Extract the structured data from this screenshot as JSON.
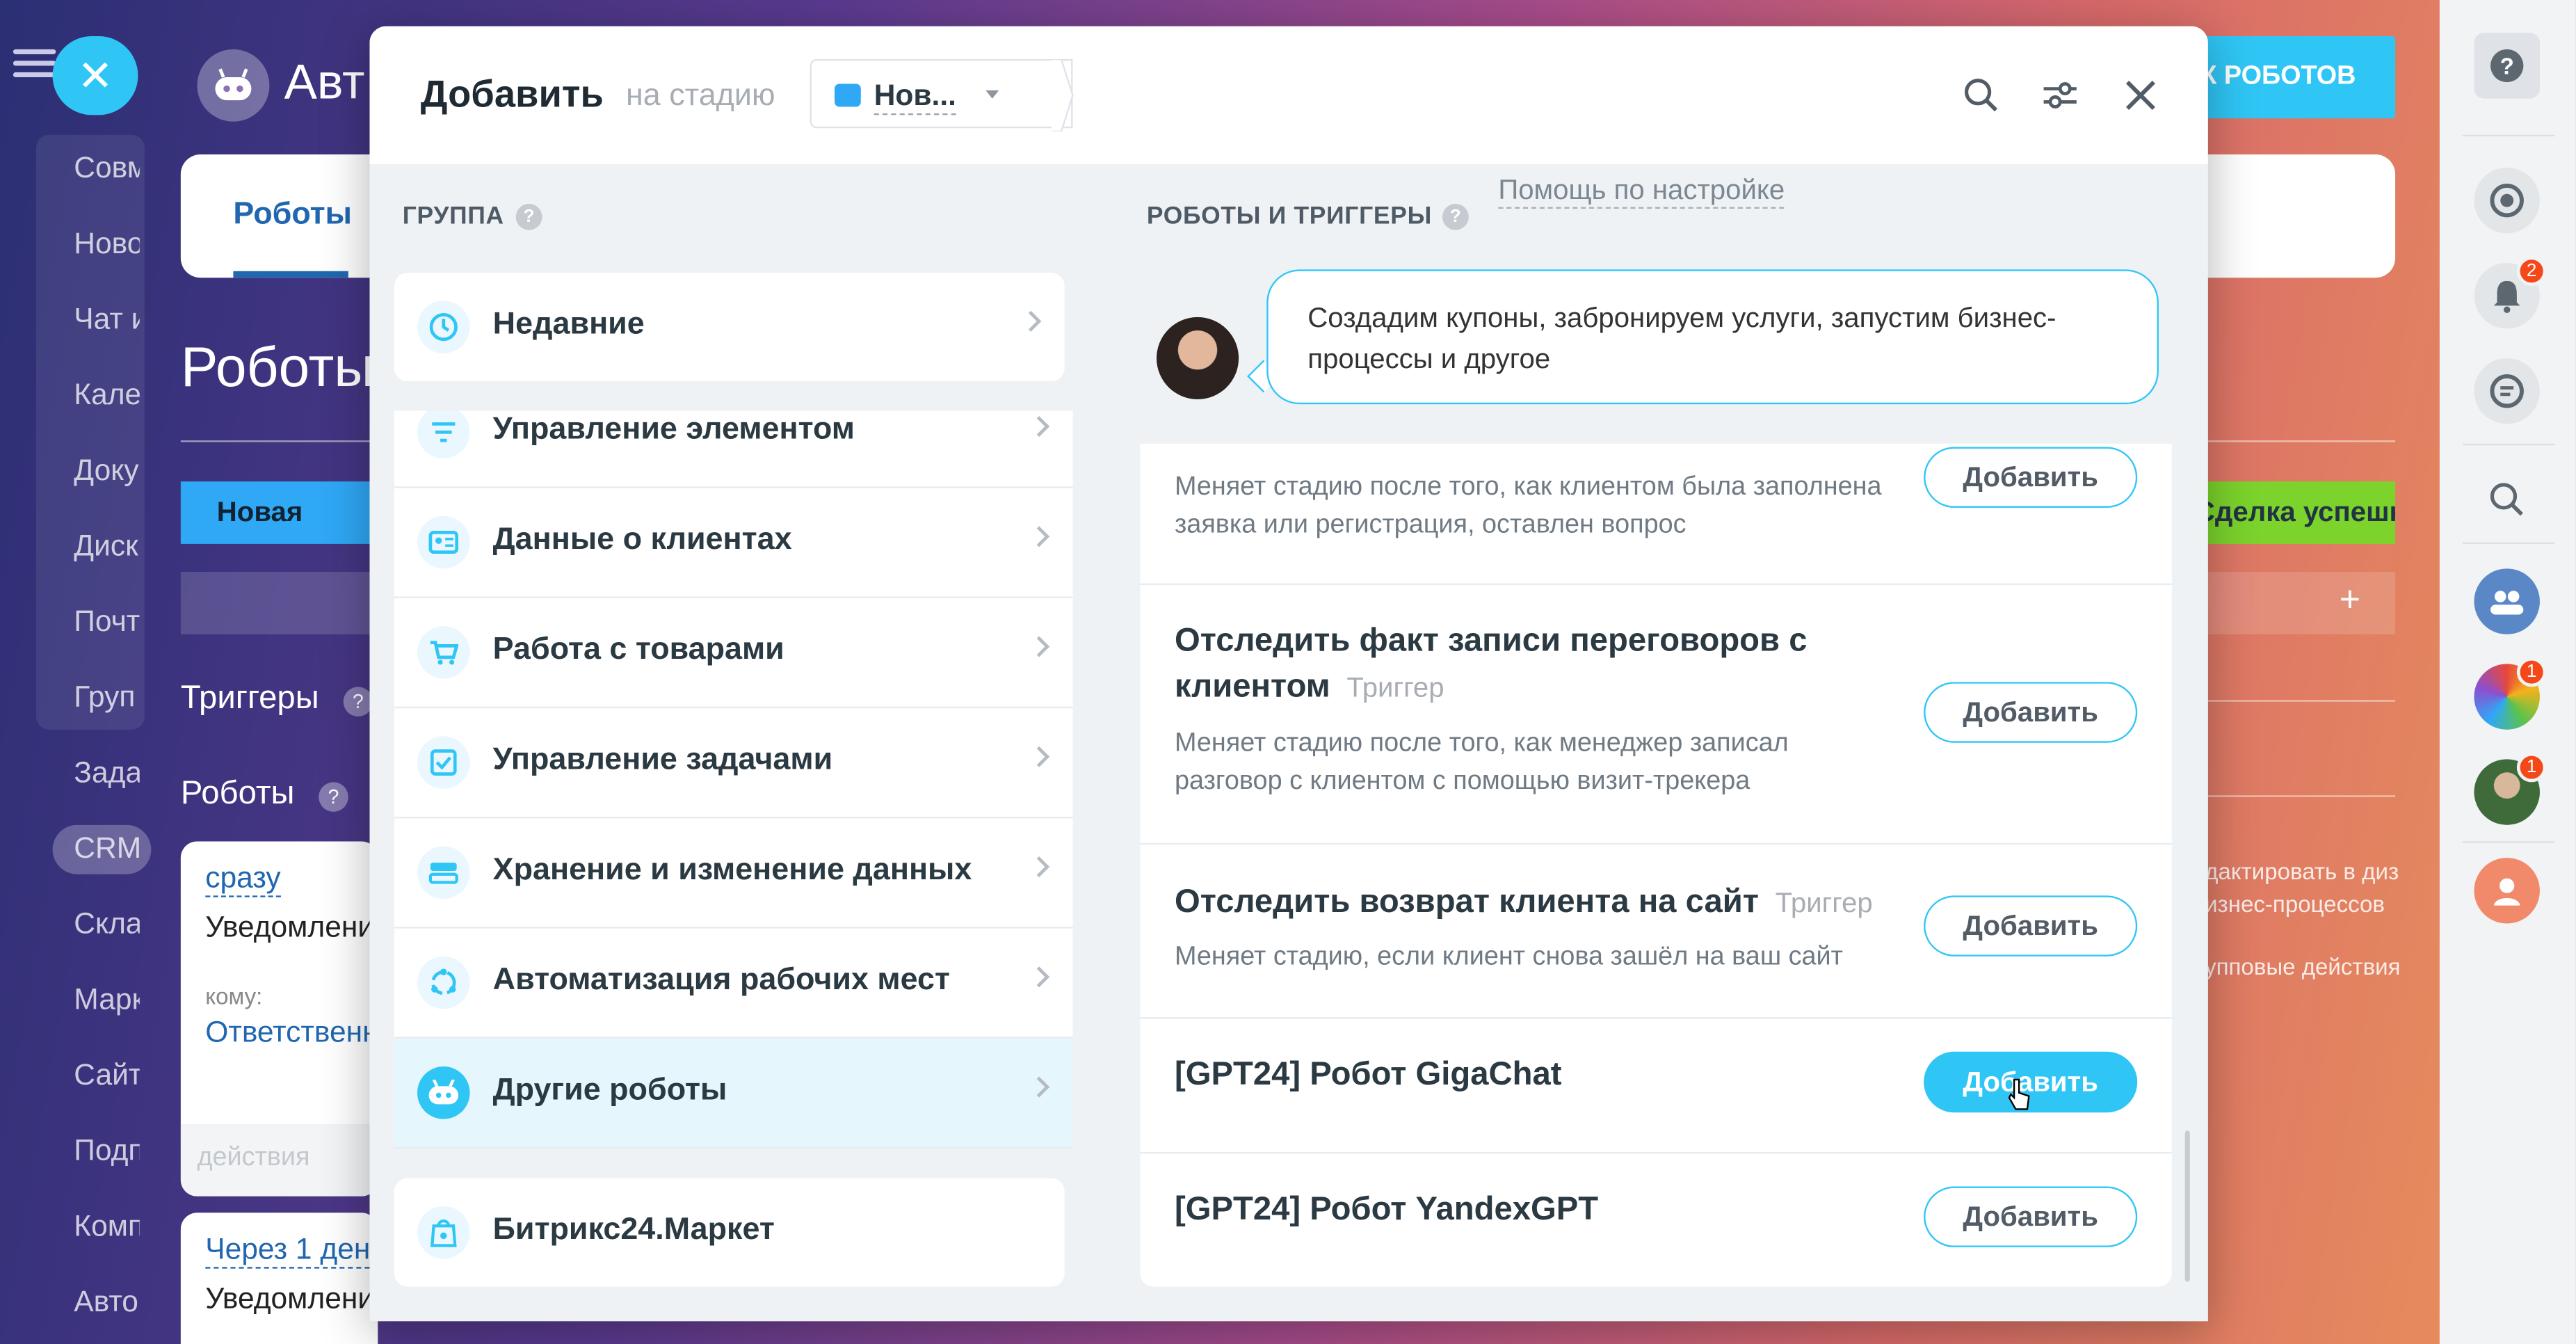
{
  "background": {
    "title_fragment": "Авт",
    "robots_button": "К РОБОТОВ",
    "tab_robots": "Роботы",
    "heading": "Роботы",
    "stage_new": "Новая",
    "stage_won": "Сделка успешн",
    "triggers_label": "Триггеры",
    "robots_label": "Роботы",
    "nav_items": [
      "Совм",
      "Ново",
      "Чат и",
      "Кале",
      "Доку",
      "Диск",
      "Почт",
      "Груп",
      "Зада",
      "CRM",
      "Скла",
      "Марк",
      "Сайт",
      "Подп",
      "Комп",
      "Авто"
    ],
    "card1": {
      "when": "сразу",
      "title": "Уведомлени",
      "to_label": "кому:",
      "to_value": "Ответственн",
      "actions": "действия"
    },
    "card2": {
      "when": "Через 1 ден",
      "title": "Уведомлени"
    },
    "note1": "дактировать в диз",
    "note2": "изнес-процессов",
    "note3": "упповые действия"
  },
  "modal": {
    "title": "Добавить",
    "subtitle": "на стадию",
    "stage": {
      "label": "Нов...",
      "color": "#2fa8f6"
    },
    "left": {
      "heading": "ГРУППА",
      "recent": "Недавние",
      "groups": [
        {
          "label": "Управление элементом",
          "icon": "filter-icon"
        },
        {
          "label": "Данные о клиентах",
          "icon": "contact-card-icon"
        },
        {
          "label": "Работа с товарами",
          "icon": "cart-icon"
        },
        {
          "label": "Управление задачами",
          "icon": "task-check-icon"
        },
        {
          "label": "Хранение и изменение данных",
          "icon": "storage-icon"
        },
        {
          "label": "Автоматизация рабочих мест",
          "icon": "workflow-icon"
        },
        {
          "label": "Другие роботы",
          "icon": "robot-icon",
          "active": true
        }
      ],
      "market": "Битрикс24.Маркет"
    },
    "right": {
      "heading": "РОБОТЫ И ТРИГГЕРЫ",
      "help_link": "Помощь по настройке",
      "hint": "Создадим купоны, забронируем услуги, запустим бизнес-процессы и другое",
      "items": [
        {
          "title": "",
          "tag": "",
          "desc": "Меняет стадию после того, как клиентом была заполнена заявка или регистрация, оставлен вопрос",
          "button": "Добавить"
        },
        {
          "title": "Отследить факт записи переговоров с клиентом",
          "tag": "Триггер",
          "desc": "Меняет стадию после того, как менеджер записал разговор с клиентом с помощью визит-трекера",
          "button": "Добавить"
        },
        {
          "title": "Отследить возврат клиента на сайт",
          "tag": "Триггер",
          "desc": "Меняет стадию, если клиент снова зашёл на ваш сайт",
          "button": "Добавить"
        },
        {
          "title": "[GPT24] Робот GigaChat",
          "tag": "",
          "desc": "",
          "button": "Добавить"
        },
        {
          "title": "[GPT24] Робот YandexGPT",
          "tag": "",
          "desc": "",
          "button": "Добавить"
        }
      ]
    }
  },
  "right_bar": {
    "notifications_badge": "2",
    "app1_badge": "1",
    "app2_badge": "1"
  },
  "colors": {
    "accent": "#2fc6f6",
    "link": "#2067b0"
  }
}
